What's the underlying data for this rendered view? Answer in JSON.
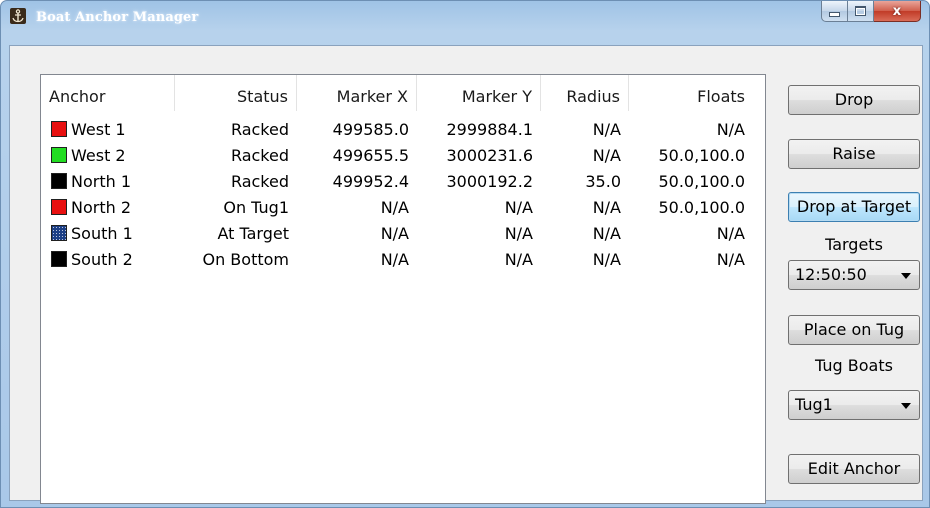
{
  "window": {
    "title": "Boat Anchor Manager",
    "icon": "anchor-icon",
    "controls": {
      "minimize_icon": "minimize-icon",
      "maximize_icon": "maximize-icon",
      "close_glyph": "x"
    }
  },
  "table": {
    "columns": [
      "Anchor",
      "Status",
      "Marker X",
      "Marker Y",
      "Radius",
      "Floats"
    ],
    "rows": [
      {
        "color": "#e81010",
        "anchor": "West 1",
        "status": "Racked",
        "marker_x": "499585.0",
        "marker_y": "2999884.1",
        "radius": "N/A",
        "floats": "N/A"
      },
      {
        "color": "#22dd22",
        "anchor": "West 2",
        "status": "Racked",
        "marker_x": "499655.5",
        "marker_y": "3000231.6",
        "radius": "N/A",
        "floats": "50.0,100.0"
      },
      {
        "color": "#000000",
        "anchor": "North 1",
        "status": "Racked",
        "marker_x": "499952.4",
        "marker_y": "3000192.2",
        "radius": "35.0",
        "floats": "50.0,100.0"
      },
      {
        "color": "#e81010",
        "anchor": "North 2",
        "status": "On Tug1",
        "marker_x": "N/A",
        "marker_y": "N/A",
        "radius": "N/A",
        "floats": "50.0,100.0"
      },
      {
        "color": "#1c3f86",
        "anchor": "South 1",
        "status": "At Target",
        "marker_x": "N/A",
        "marker_y": "N/A",
        "radius": "N/A",
        "floats": "N/A"
      },
      {
        "color": "#000000",
        "anchor": "South 2",
        "status": "On Bottom",
        "marker_x": "N/A",
        "marker_y": "N/A",
        "radius": "N/A",
        "floats": "N/A"
      }
    ]
  },
  "sidebar": {
    "drop_label": "Drop",
    "raise_label": "Raise",
    "drop_at_target_label": "Drop at Target",
    "targets_label": "Targets",
    "targets_value": "12:50:50",
    "place_on_tug_label": "Place on Tug",
    "tug_boats_label": "Tug Boats",
    "tug_value": "Tug1",
    "edit_anchor_label": "Edit Anchor"
  }
}
